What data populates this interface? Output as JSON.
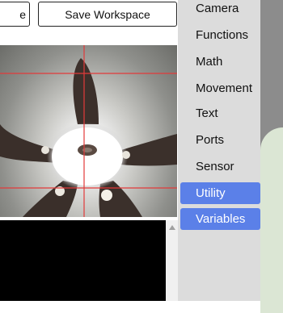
{
  "toolbar": {
    "left_button_label": "e",
    "save_button_label": "Save Workspace"
  },
  "categories": [
    {
      "label": "Camera",
      "active": false
    },
    {
      "label": "Functions",
      "active": false
    },
    {
      "label": "Math",
      "active": false
    },
    {
      "label": "Movement",
      "active": false
    },
    {
      "label": "Text",
      "active": false
    },
    {
      "label": "Ports",
      "active": false
    },
    {
      "label": "Sensor",
      "active": false
    },
    {
      "label": "Utility",
      "active": true
    },
    {
      "label": "Variables",
      "active": true
    }
  ],
  "colors": {
    "category_active": "#5b80e8",
    "crosshair": "#e23a3a",
    "console_background": "#000000"
  }
}
